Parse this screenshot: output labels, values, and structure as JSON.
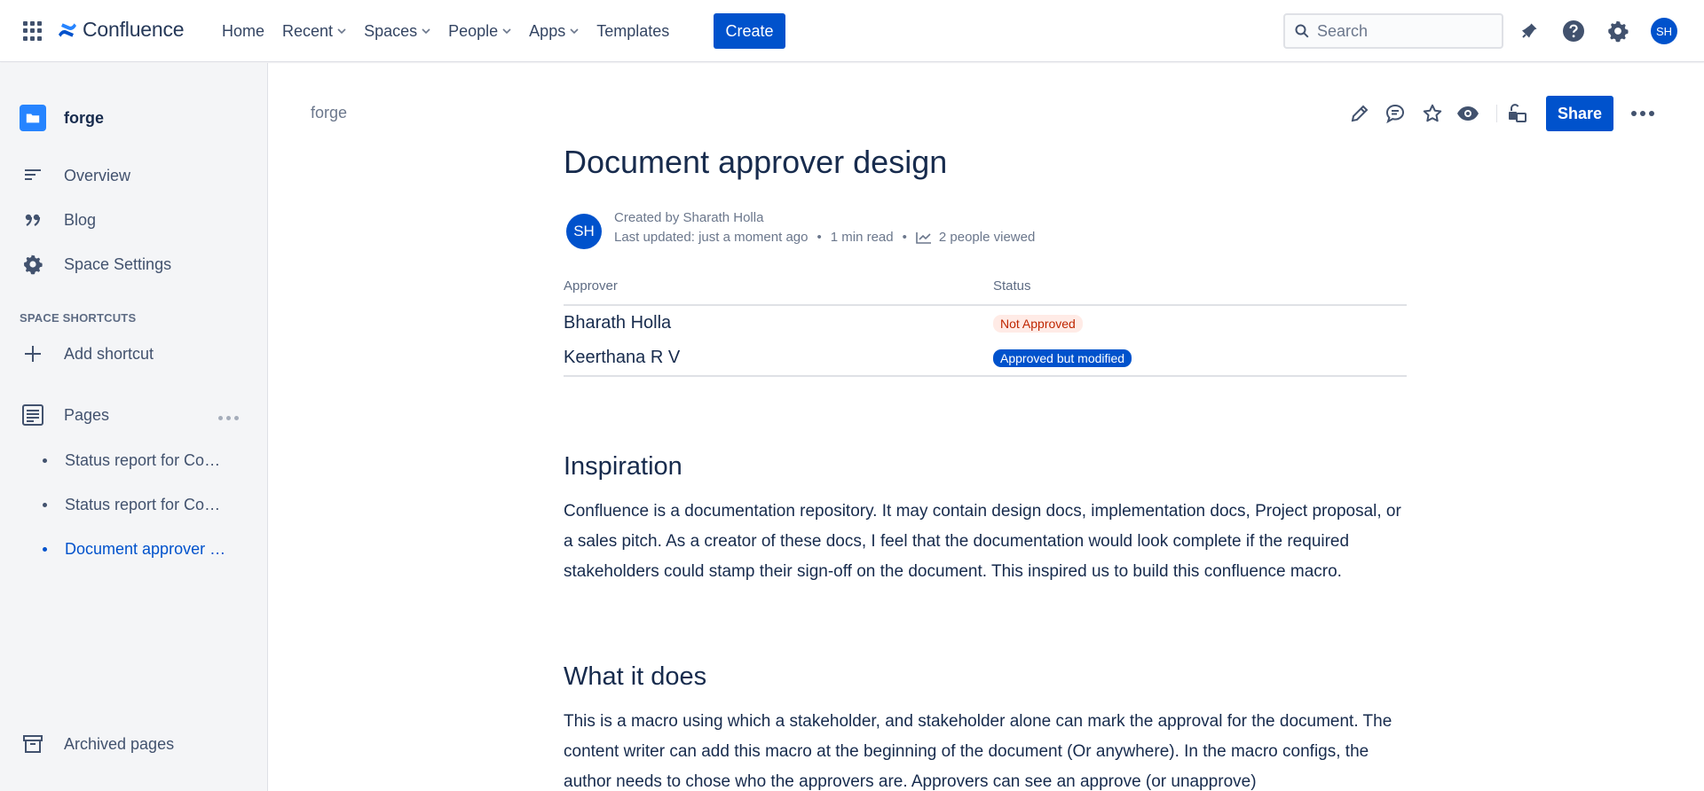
{
  "topnav": {
    "app_name": "Confluence",
    "links": [
      "Home",
      "Recent",
      "Spaces",
      "People",
      "Apps",
      "Templates"
    ],
    "create_label": "Create",
    "search_placeholder": "Search",
    "avatar_initials": "SH",
    "brand_color": "#0052CC"
  },
  "sidebar": {
    "space_name": "forge",
    "items": [
      "Overview",
      "Blog",
      "Space Settings"
    ],
    "shortcuts_heading": "SPACE SHORTCUTS",
    "add_shortcut": "Add shortcut",
    "pages_label": "Pages",
    "pages": [
      "Status report for Code…",
      "Status report for Code…",
      "Document approver d…"
    ],
    "archived": "Archived pages"
  },
  "page": {
    "breadcrumb": "forge",
    "share_label": "Share",
    "title": "Document approver design",
    "author_initials": "SH",
    "created_by": "Created by Sharath Holla",
    "last_updated": "Last updated: just a moment ago",
    "read_time": "1 min read",
    "viewed": "2 people viewed",
    "table": {
      "headers": [
        "Approver",
        "Status"
      ],
      "rows": [
        {
          "approver": "Bharath Holla",
          "status": "Not Approved"
        },
        {
          "approver": "Keerthana R V",
          "status": "Approved but modified"
        }
      ]
    },
    "sections": [
      {
        "heading": "Inspiration",
        "text": "Confluence is a documentation repository. It may contain design docs, implementation docs, Project proposal, or a sales pitch. As a creator of these docs, I feel that the documentation would look complete if the required stakeholders could stamp their sign-off on the document. This inspired us to build this confluence macro."
      },
      {
        "heading": "What it does",
        "text": "This is a macro using which a stakeholder, and stakeholder alone can mark the approval for the document. The content writer can add this macro at the beginning of the document (Or anywhere). In the macro configs, the author needs to chose who the approvers are. Approvers can see an approve (or unapprove)"
      }
    ]
  }
}
